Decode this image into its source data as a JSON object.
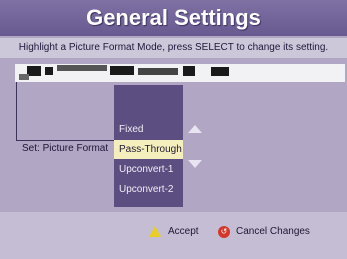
{
  "screen": {
    "title": "General Settings",
    "instruction": "Highlight a Picture Format Mode, press SELECT to change its setting."
  },
  "setting": {
    "label": "Set: Picture Format",
    "options": [
      "Fixed",
      "Pass-Through",
      "Upconvert-1",
      "Upconvert-2"
    ],
    "selected": "Pass-Through"
  },
  "footer": {
    "accept_label": "Accept",
    "cancel_label": "Cancel Changes"
  },
  "colors": {
    "accent_yellow": "#e7cf24",
    "cancel_red": "#d3382b",
    "panel_purple": "#5c4e80",
    "highlight": "#f5efbd"
  },
  "icons": {
    "accept": "yellow-triangle-icon",
    "cancel": "red-circle-icon",
    "scroll_up": "up-arrow-icon",
    "scroll_down": "down-arrow-icon"
  }
}
